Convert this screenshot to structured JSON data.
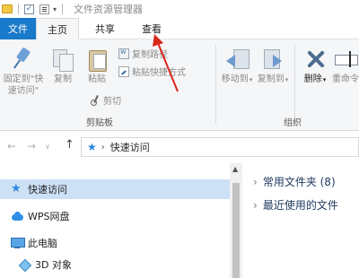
{
  "window": {
    "title": "文件资源管理器"
  },
  "tabs": [
    {
      "label": "文件"
    },
    {
      "label": "主页"
    },
    {
      "label": "共享"
    },
    {
      "label": "查看"
    }
  ],
  "ribbon": {
    "pin": {
      "line1": "固定到\"快",
      "line2": "速访问\""
    },
    "copy": "复制",
    "paste": "粘贴",
    "copy_path": "复制路径",
    "paste_shortcut": "粘贴快捷方式",
    "cut": "剪切",
    "clipboard_group": "剪贴板",
    "move_to": "移动到",
    "copy_to": "复制到",
    "delete": "删除",
    "rename": "重命令",
    "organize_group": "组织"
  },
  "address": {
    "back": "←",
    "forward": "→",
    "up": "↑",
    "current": "快速访问"
  },
  "nav": {
    "items": [
      {
        "label": "快速访问",
        "selected": true
      },
      {
        "label": "WPS网盘"
      },
      {
        "label": "此电脑"
      },
      {
        "label": "3D 对象"
      }
    ]
  },
  "content": {
    "sections": [
      {
        "label": "常用文件夹 (8)"
      },
      {
        "label": "最近使用的文件"
      }
    ]
  },
  "colors": {
    "file_tab": "#1979ca",
    "selection": "#cce0f6",
    "annotation_arrow": "#d9261c"
  }
}
